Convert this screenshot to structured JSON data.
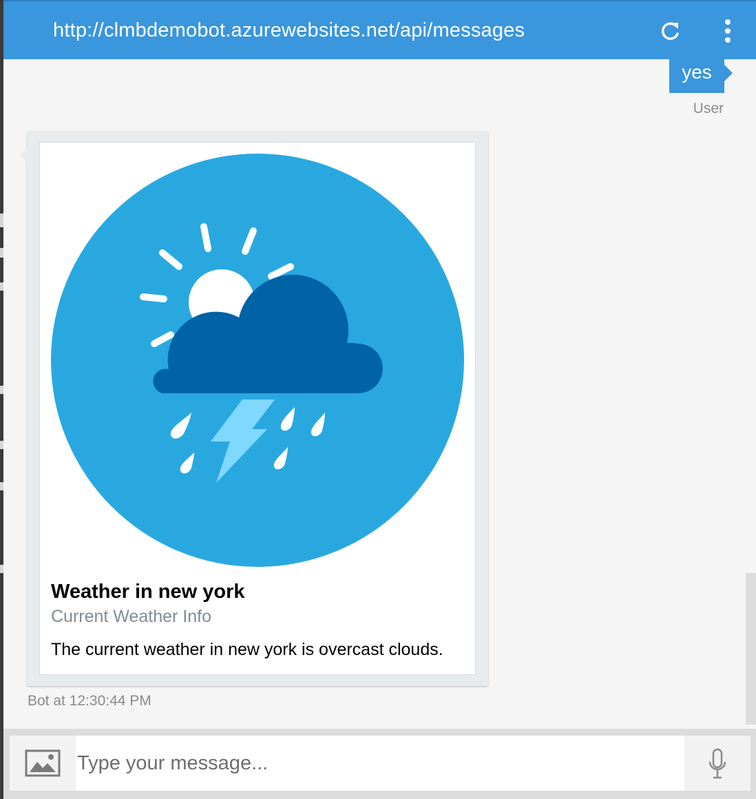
{
  "window": {
    "url": "http://clmbdemobot.azurewebsites.net/api/messages",
    "icons": {
      "refresh": "refresh-icon",
      "menu": "more-vertical-icon"
    }
  },
  "messages": {
    "user": {
      "text": "yes",
      "sender": "User"
    },
    "bot": {
      "card": {
        "image": "weather-storm-icon",
        "title": "Weather in new york",
        "subtitle": "Current Weather Info",
        "text": "The current weather in new york is overcast clouds."
      },
      "timestamp": "Bot at 12:30:44 PM"
    }
  },
  "composer": {
    "placeholder": "Type your message...",
    "icons": {
      "upload": "image-upload-icon",
      "mic": "microphone-icon"
    }
  },
  "colors": {
    "accent": "#3a96dd",
    "weather_circle": "#29a8e0",
    "cloud": "#0063a6",
    "lightning": "#80d8ff"
  }
}
